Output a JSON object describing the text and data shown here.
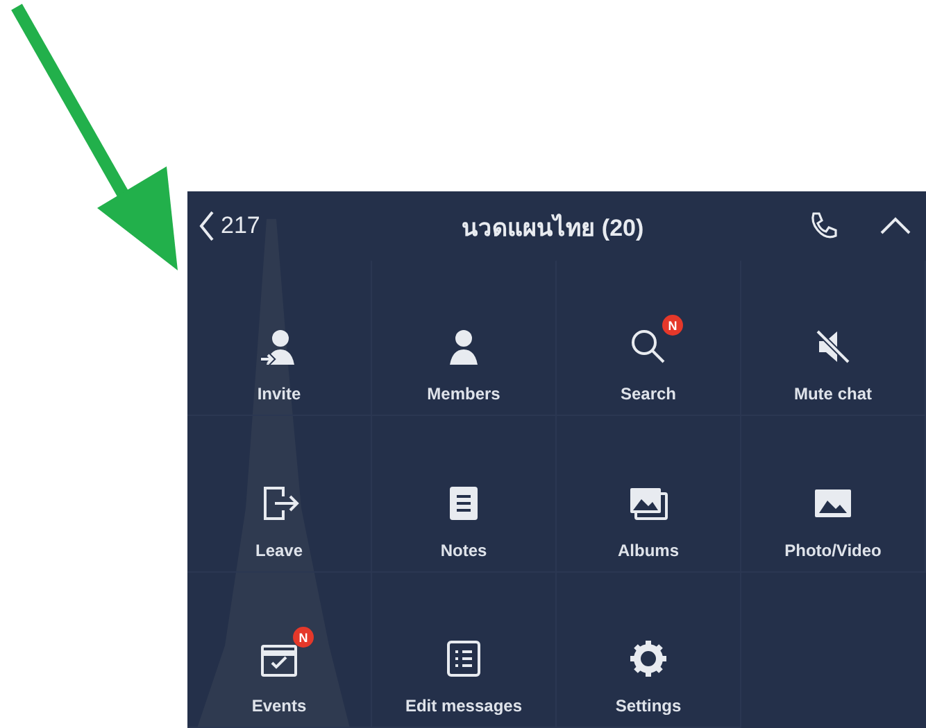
{
  "header": {
    "back_count": "217",
    "title": "นวดแผนไทย (20)"
  },
  "menu_items": [
    {
      "kind": "invite",
      "label": "Invite"
    },
    {
      "kind": "members",
      "label": "Members"
    },
    {
      "kind": "search",
      "label": "Search",
      "badge": "N"
    },
    {
      "kind": "mute",
      "label": "Mute chat"
    },
    {
      "kind": "leave",
      "label": "Leave"
    },
    {
      "kind": "notes",
      "label": "Notes"
    },
    {
      "kind": "albums",
      "label": "Albums"
    },
    {
      "kind": "photo",
      "label": "Photo/Video"
    },
    {
      "kind": "events",
      "label": "Events",
      "badge": "N"
    },
    {
      "kind": "edit",
      "label": "Edit messages"
    },
    {
      "kind": "settings",
      "label": "Settings"
    }
  ]
}
